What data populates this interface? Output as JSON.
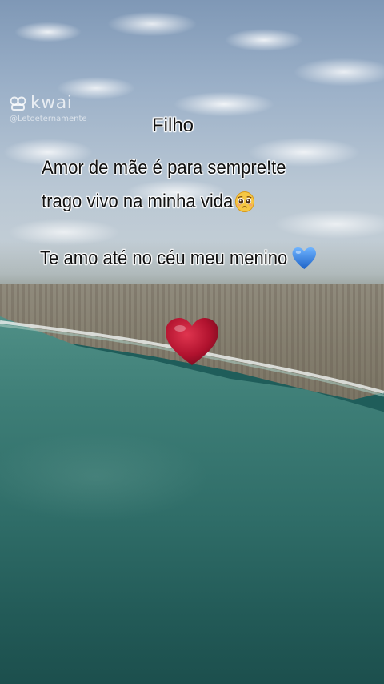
{
  "watermark": {
    "logo_text": "kwai",
    "handle": "@Letoeternamente"
  },
  "message": {
    "title": "Filho",
    "line1": "Amor de mãe é para sempre!te",
    "line2": "trago vivo na minha vida",
    "line3": "Te amo até no céu meu menino"
  },
  "emojis": {
    "pleading_face": "pleading-face-emoji",
    "blue_heart": "blue-heart-emoji",
    "red_heart": "red-heart-emoji"
  },
  "colors": {
    "text": "#111111",
    "text_outline": "#ffffff",
    "sea": "#2f6d68",
    "sky": "#9bb0c8",
    "heart_red": "#b0122e",
    "heart_blue": "#2e7fe0",
    "face_yellow": "#f6c744"
  }
}
